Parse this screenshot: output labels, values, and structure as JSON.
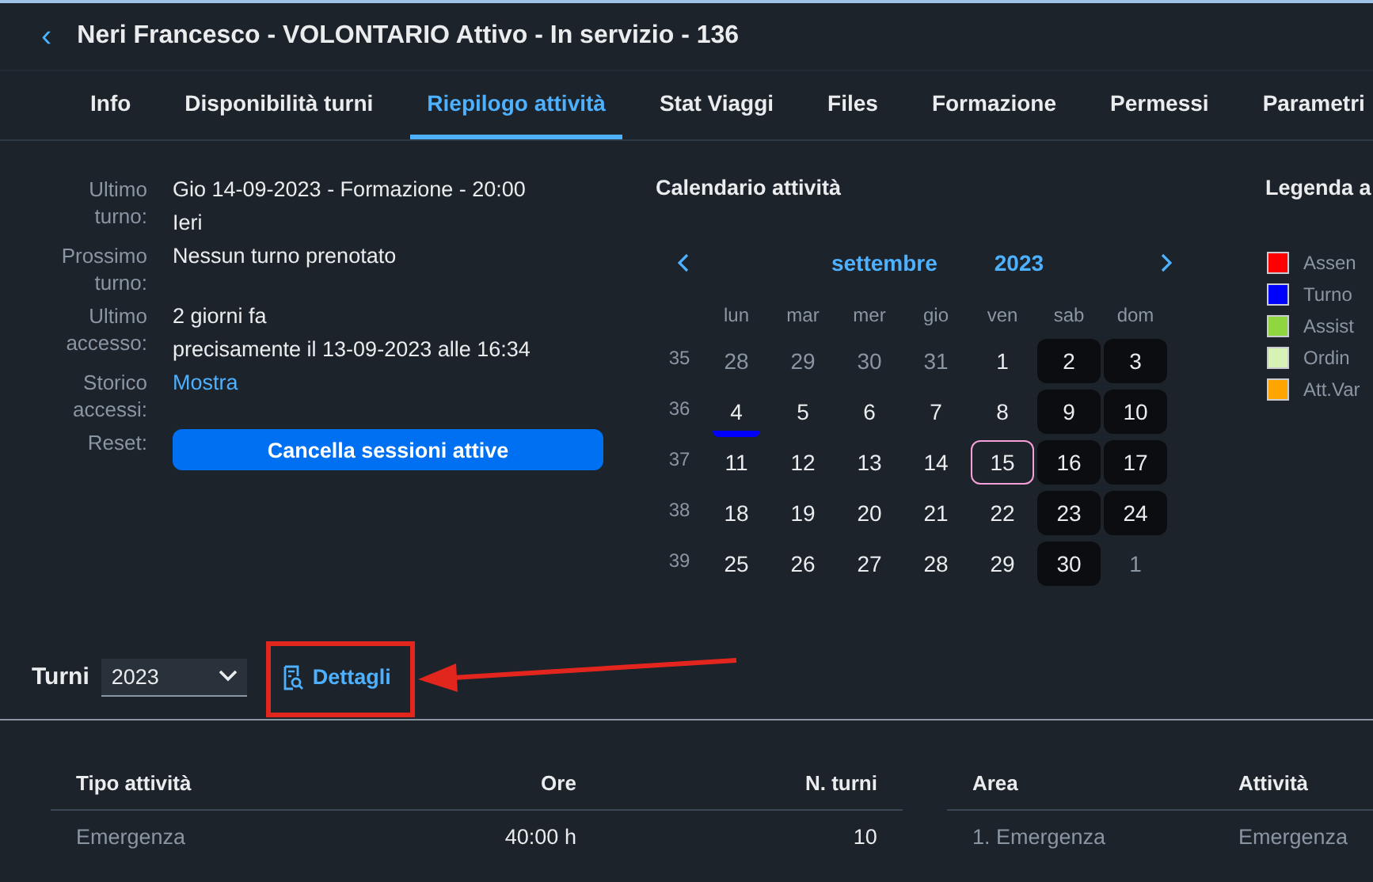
{
  "header": {
    "back_icon": "‹",
    "title": "Neri Francesco - VOLONTARIO Attivo - In servizio - 136"
  },
  "tabs": [
    {
      "label": "Info",
      "selected": false
    },
    {
      "label": "Disponibilità turni",
      "selected": false
    },
    {
      "label": "Riepilogo attività",
      "selected": true
    },
    {
      "label": "Stat Viaggi",
      "selected": false
    },
    {
      "label": "Files",
      "selected": false
    },
    {
      "label": "Formazione",
      "selected": false
    },
    {
      "label": "Permessi",
      "selected": false
    },
    {
      "label": "Parametri",
      "selected": false
    }
  ],
  "info": [
    {
      "label": "Ultimo turno:",
      "kind": "text",
      "values": [
        "Gio 14-09-2023 - Formazione - 20:00",
        "Ieri"
      ]
    },
    {
      "label": "Prossimo turno:",
      "kind": "text",
      "values": [
        "Nessun turno prenotato"
      ]
    },
    {
      "label": "Ultimo accesso:",
      "kind": "text",
      "values": [
        "2 giorni fa",
        "precisamente il 13-09-2023 alle 16:34"
      ]
    },
    {
      "label": "Storico accessi:",
      "kind": "link",
      "values": [
        "Mostra"
      ]
    },
    {
      "label": "Reset:",
      "kind": "button",
      "values": [
        "Cancella sessioni attive"
      ]
    }
  ],
  "calendar": {
    "title": "Calendario attività",
    "month": "settembre",
    "year": "2023",
    "weekdays": [
      "lun",
      "mar",
      "mer",
      "gio",
      "ven",
      "sab",
      "dom"
    ],
    "weeks": [
      {
        "number": "35",
        "days": [
          {
            "label": "28",
            "muted": true,
            "weekend": false,
            "today": false
          },
          {
            "label": "29",
            "muted": true,
            "weekend": false,
            "today": false
          },
          {
            "label": "30",
            "muted": true,
            "weekend": false,
            "today": false
          },
          {
            "label": "31",
            "muted": true,
            "weekend": false,
            "today": false
          },
          {
            "label": "1",
            "muted": false,
            "weekend": false,
            "today": false
          },
          {
            "label": "2",
            "muted": false,
            "weekend": true,
            "today": false
          },
          {
            "label": "3",
            "muted": false,
            "weekend": true,
            "today": false
          }
        ]
      },
      {
        "number": "36",
        "days": [
          {
            "label": "4",
            "muted": false,
            "weekend": false,
            "today": false,
            "color": "#0000ff"
          },
          {
            "label": "5",
            "muted": false,
            "weekend": false,
            "today": false
          },
          {
            "label": "6",
            "muted": false,
            "weekend": false,
            "today": false
          },
          {
            "label": "7",
            "muted": false,
            "weekend": false,
            "today": false
          },
          {
            "label": "8",
            "muted": false,
            "weekend": false,
            "today": false
          },
          {
            "label": "9",
            "muted": false,
            "weekend": true,
            "today": false
          },
          {
            "label": "10",
            "muted": false,
            "weekend": true,
            "today": false
          }
        ]
      },
      {
        "number": "37",
        "days": [
          {
            "label": "11",
            "muted": false,
            "weekend": false,
            "today": false
          },
          {
            "label": "12",
            "muted": false,
            "weekend": false,
            "today": false
          },
          {
            "label": "13",
            "muted": false,
            "weekend": false,
            "today": false
          },
          {
            "label": "14",
            "muted": false,
            "weekend": false,
            "today": false
          },
          {
            "label": "15",
            "muted": false,
            "weekend": false,
            "today": true
          },
          {
            "label": "16",
            "muted": false,
            "weekend": true,
            "today": false
          },
          {
            "label": "17",
            "muted": false,
            "weekend": true,
            "today": false
          }
        ]
      },
      {
        "number": "38",
        "days": [
          {
            "label": "18",
            "muted": false,
            "weekend": false,
            "today": false
          },
          {
            "label": "19",
            "muted": false,
            "weekend": false,
            "today": false
          },
          {
            "label": "20",
            "muted": false,
            "weekend": false,
            "today": false
          },
          {
            "label": "21",
            "muted": false,
            "weekend": false,
            "today": false
          },
          {
            "label": "22",
            "muted": false,
            "weekend": false,
            "today": false
          },
          {
            "label": "23",
            "muted": false,
            "weekend": true,
            "today": false
          },
          {
            "label": "24",
            "muted": false,
            "weekend": true,
            "today": false
          }
        ]
      },
      {
        "number": "39",
        "days": [
          {
            "label": "25",
            "muted": false,
            "weekend": false,
            "today": false
          },
          {
            "label": "26",
            "muted": false,
            "weekend": false,
            "today": false
          },
          {
            "label": "27",
            "muted": false,
            "weekend": false,
            "today": false
          },
          {
            "label": "28",
            "muted": false,
            "weekend": false,
            "today": false
          },
          {
            "label": "29",
            "muted": false,
            "weekend": false,
            "today": false
          },
          {
            "label": "30",
            "muted": false,
            "weekend": true,
            "today": false
          },
          {
            "label": "1",
            "muted": true,
            "weekend": false,
            "today": false
          }
        ]
      }
    ]
  },
  "legend": {
    "title": "Legenda a",
    "items": [
      {
        "label": "Assen",
        "color": "#ff0000"
      },
      {
        "label": "Turno",
        "color": "#0000ff"
      },
      {
        "label": "Assist",
        "color": "#8fd63f"
      },
      {
        "label": "Ordin",
        "color": "#d6f2b5"
      },
      {
        "label": "Att.Var",
        "color": "#ffa500"
      }
    ]
  },
  "toolbar": {
    "label": "Turni",
    "year": "2023",
    "details": "Dettagli"
  },
  "summary_table": {
    "columns": [
      "Tipo attività",
      "Ore",
      "N. turni"
    ],
    "rows": [
      [
        "Emergenza",
        "40:00 h",
        "10"
      ]
    ]
  },
  "area_table": {
    "columns": [
      "Area",
      "Attività"
    ],
    "rows": [
      [
        "1. Emergenza",
        "Emergenza"
      ]
    ]
  }
}
